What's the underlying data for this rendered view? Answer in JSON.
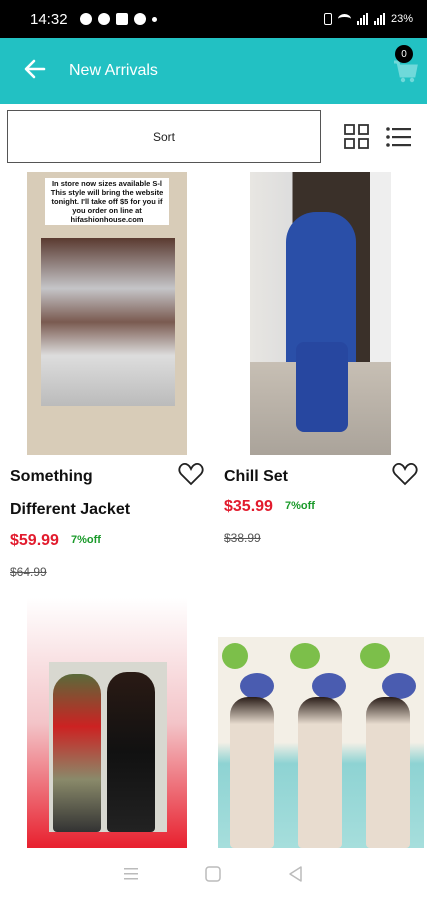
{
  "status": {
    "time": "14:32",
    "battery": "23%"
  },
  "header": {
    "title": "New Arrivals",
    "cart_count": "0"
  },
  "toolbar": {
    "sort_label": "Sort"
  },
  "flyer": {
    "text": "In store now sizes available S-l This style will bring the website tonight. I'll take off $5 for you if you order on line at hifashionhouse.com"
  },
  "products": [
    {
      "name_line1": "Something",
      "name_line2": "Different Jacket",
      "price": "$59.99",
      "discount": "7%off",
      "old_price": "$64.99"
    },
    {
      "name_line1": "Chill Set",
      "name_line2": "",
      "price": "$35.99",
      "discount": "7%off",
      "old_price": "$38.99"
    }
  ],
  "colors": {
    "accent": "#22c1c3",
    "price": "#e21b2d",
    "discount": "#1a9a2a"
  }
}
